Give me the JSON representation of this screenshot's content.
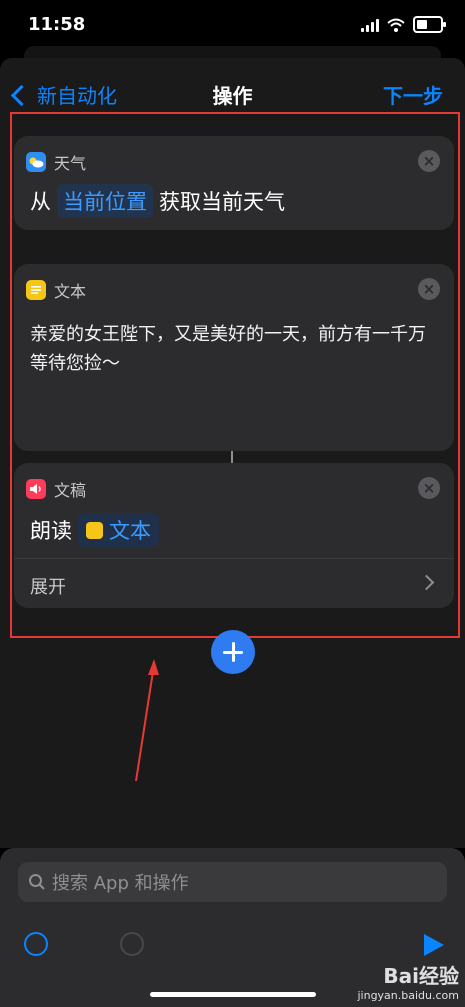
{
  "status_bar": {
    "time": "11:58"
  },
  "nav": {
    "back_label": "新自动化",
    "title": "操作",
    "next_label": "下一步"
  },
  "weather_card": {
    "app_name": "天气",
    "prefix": "从",
    "token": "当前位置",
    "suffix": "获取当前天气"
  },
  "text_card": {
    "app_name": "文本",
    "content": "亲爱的女王陛下，又是美好的一天，前方有一千万等待您捡～"
  },
  "speak_card": {
    "app_name": "文稿",
    "verb": "朗读",
    "token": "文本",
    "expand_label": "展开"
  },
  "search": {
    "placeholder": "搜索 App 和操作"
  },
  "watermark": {
    "main": "Bai经验",
    "sub": "jingyan.baidu.com"
  },
  "colors": {
    "accent": "#0a84ff",
    "highlight_frame": "#e53935",
    "card": "#2c2c2e"
  }
}
